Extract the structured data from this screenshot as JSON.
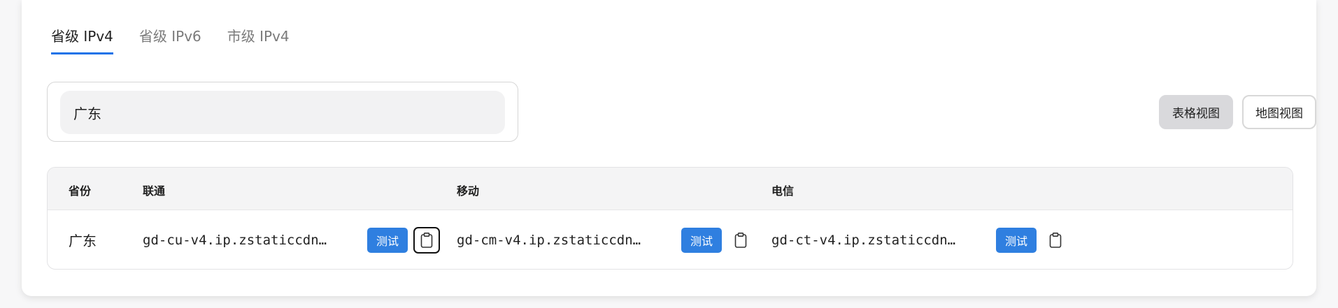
{
  "tabs": [
    {
      "label": "省级 IPv4",
      "active": true
    },
    {
      "label": "省级 IPv6",
      "active": false
    },
    {
      "label": "市级 IPv4",
      "active": false
    }
  ],
  "search": {
    "value": "广东",
    "placeholder": ""
  },
  "view_toggle": {
    "table_label": "表格视图",
    "map_label": "地图视图",
    "selected": "table"
  },
  "table": {
    "headers": [
      "省份",
      "联通",
      "移动",
      "电信"
    ],
    "rows": [
      {
        "province": "广东",
        "unicom": {
          "host": "gd-cu-v4.ip.zstaticcdn…",
          "test_label": "测试"
        },
        "mobile": {
          "host": "gd-cm-v4.ip.zstaticcdn…",
          "test_label": "测试"
        },
        "telecom": {
          "host": "gd-ct-v4.ip.zstaticcdn…",
          "test_label": "测试"
        }
      }
    ]
  },
  "colors": {
    "accent": "#1a73e8",
    "test_button": "#2f7fe0"
  },
  "icons": {
    "copy": "clipboard-icon"
  }
}
